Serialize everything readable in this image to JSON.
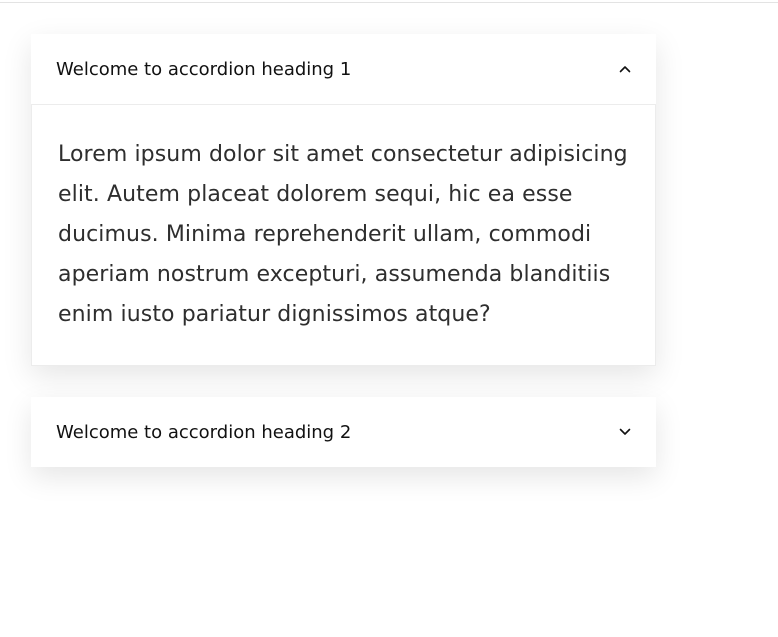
{
  "accordion": {
    "items": [
      {
        "heading": "Welcome to accordion heading 1",
        "expanded": true,
        "icon": "chevron-up-icon",
        "body": "Lorem ipsum dolor sit amet consectetur adipisicing elit. Autem placeat dolorem sequi, hic ea esse ducimus. Minima reprehenderit ullam, commodi aperiam nostrum excepturi, assumenda blanditiis enim iusto pariatur dignissimos atque?"
      },
      {
        "heading": "Welcome to accordion heading 2",
        "expanded": false,
        "icon": "chevron-down-icon"
      }
    ]
  },
  "colors": {
    "text": "#111111",
    "body_text": "#2e2e2e",
    "border": "#ececec",
    "background": "#ffffff"
  }
}
